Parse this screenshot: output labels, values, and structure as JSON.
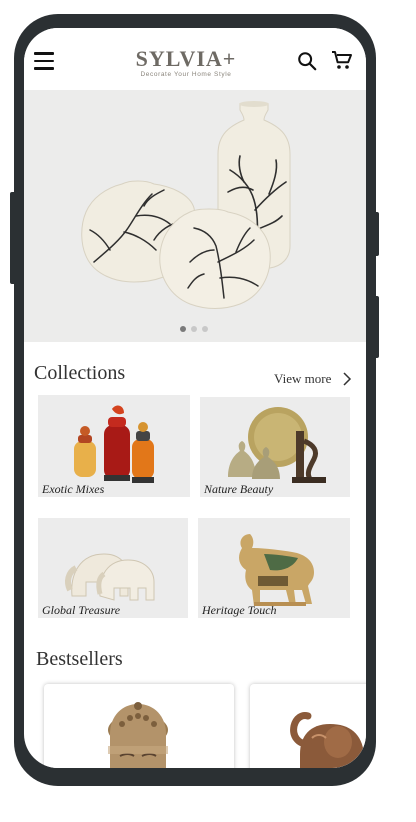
{
  "brand": {
    "name": "SYLVIA+",
    "tagline": "Decorate Your Home Style"
  },
  "header": {
    "menu_icon": "hamburger-menu-icon",
    "search_icon": "search-icon",
    "cart_icon": "shopping-cart-icon"
  },
  "hero": {
    "slide_count": 3,
    "active_slide": 1
  },
  "collections": {
    "title": "Collections",
    "view_more": "View more",
    "items": [
      {
        "label": "Exotic Mixes"
      },
      {
        "label": "Nature Beauty"
      },
      {
        "label": "Global Treasure"
      },
      {
        "label": "Heritage Touch"
      }
    ]
  },
  "bestsellers": {
    "title": "Bestsellers"
  },
  "colors": {
    "frame": "#2b3033",
    "hero_bg": "#ececeb",
    "tile_bg": "#ececec",
    "logo": "#6e6a64"
  }
}
